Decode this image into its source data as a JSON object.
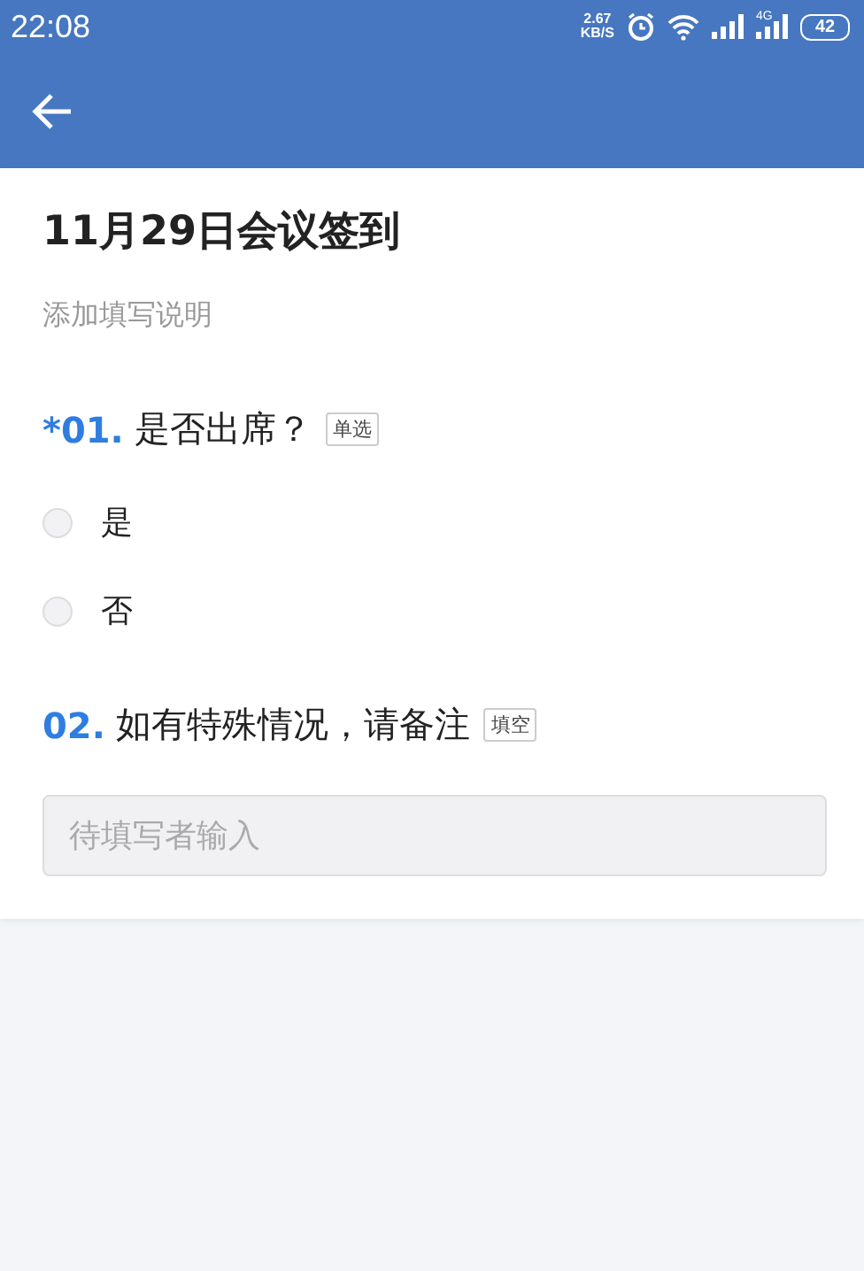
{
  "status_bar": {
    "time": "22:08",
    "net_speed": "2.67",
    "net_unit": "KB/S",
    "network_type": "4G",
    "battery": "42"
  },
  "form": {
    "title": "11月29日会议签到",
    "description": "添加填写说明",
    "questions": [
      {
        "kind": "choice",
        "number": "*01.",
        "text": "是否出席？",
        "tag": "单选",
        "options": [
          {
            "label": "是",
            "selected": false
          },
          {
            "label": "否",
            "selected": false
          }
        ]
      },
      {
        "kind": "text",
        "number": "02.",
        "text": "如有特殊情况，请备注",
        "tag": "填空",
        "placeholder": "待填写者输入"
      }
    ]
  }
}
